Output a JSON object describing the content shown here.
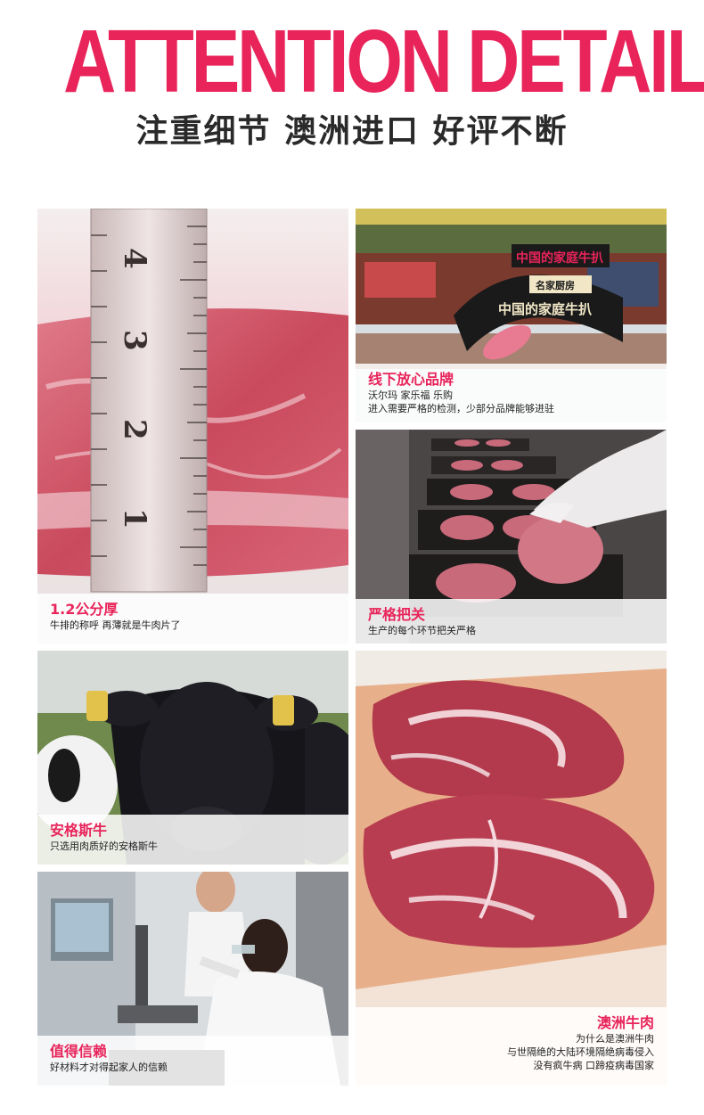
{
  "header": {
    "headline": "ATTENTION DETAIL",
    "subhead": "注重细节 澳洲进口 好评不断"
  },
  "panels": {
    "thickness": {
      "title": "1.2公分厚",
      "lines": [
        "牛排的称呼 再薄就是牛肉片了"
      ],
      "ruler_marks": [
        "1",
        "2",
        "3",
        "4"
      ]
    },
    "brand": {
      "title": "线下放心品牌",
      "lines": [
        "沃尔玛 家乐福 乐购",
        "进入需要严格的检测，少部分品牌能够进驻"
      ],
      "sign_text": "中国的家庭牛扒",
      "sign_logo": "名家厨房"
    },
    "quality": {
      "title": "严格把关",
      "lines": [
        "生产的每个环节把关严格"
      ]
    },
    "angus": {
      "title": "安格斯牛",
      "lines": [
        "只选用肉质好的安格斯牛"
      ]
    },
    "trust": {
      "title": "值得信赖",
      "lines": [
        "好材料才对得起家人的信赖"
      ]
    },
    "australia": {
      "title": "澳洲牛肉",
      "lines": [
        "为什么是澳洲牛肉",
        "与世隔绝的大陆环境隔绝病毒侵入",
        "没有疯牛病 口蹄疫病毒国家"
      ]
    }
  },
  "colors": {
    "accent": "#e8245a",
    "text": "#222222",
    "meat": "#c94a5c"
  }
}
